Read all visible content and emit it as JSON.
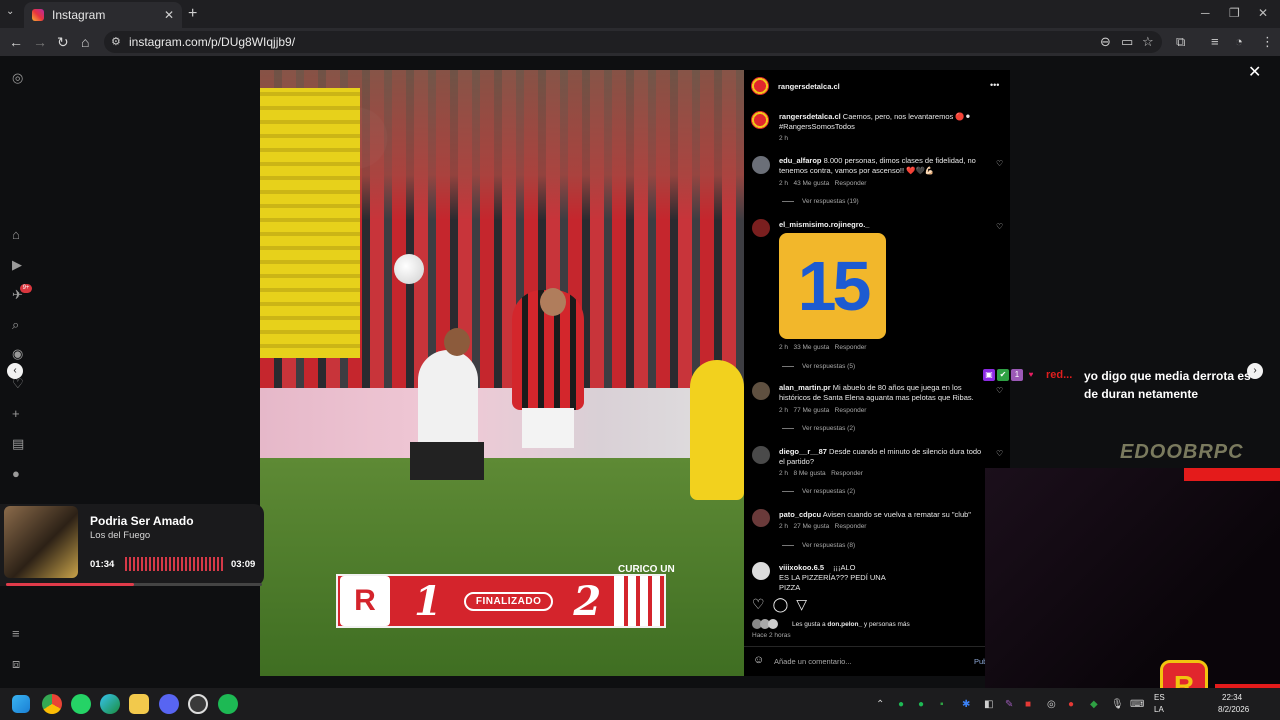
{
  "browser": {
    "tab_title": "Instagram",
    "url": "instagram.com/p/DUg8WIqjjb9/",
    "close_tab": "✕",
    "new_tab": "+"
  },
  "post": {
    "account": "rangersdetalca.cl",
    "more": "•••",
    "caption_user": "rangersdetalca.cl",
    "caption_text": "Caemos, pero, nos levantaremos 🔴⚫",
    "caption_hashtag": "#RangersSomosTodos",
    "caption_time": "2 h",
    "scoreboard": {
      "home_score": "1",
      "away_score": "2",
      "status": "FINALIZADO",
      "away_name": "CURICO UN",
      "home_logo": "R"
    }
  },
  "comments": [
    {
      "user": "edu_alfarop",
      "text": "8.000 personas, dimos clases de fidelidad, no tenemos contra, vamos por ascenso!! ❤️🖤💪🏻",
      "time": "2 h",
      "likes": "43 Me gusta",
      "reply": "Responder",
      "replies": "Ver respuestas (19)"
    },
    {
      "user": "el_mismisimo.rojinegro._",
      "text": "",
      "sticker": "15",
      "time": "2 h",
      "likes": "33 Me gusta",
      "reply": "Responder",
      "replies": "Ver respuestas (5)"
    },
    {
      "user": "alan_martin.pr",
      "text": "Mi abuelo de 80 años que juega en los históricos de Santa Elena aguanta mas pelotas que Ribas.",
      "time": "2 h",
      "likes": "77 Me gusta",
      "reply": "Responder",
      "replies": "Ver respuestas (2)"
    },
    {
      "user": "diego__r__87",
      "text": "Desde cuando el minuto de silencio dura todo el partido?",
      "time": "2 h",
      "likes": "8 Me gusta",
      "reply": "Responder",
      "replies": "Ver respuestas (2)"
    },
    {
      "user": "pato_cdpcu",
      "text": "Avisen cuando se vuelva a rematar su \"club\"",
      "time": "2 h",
      "likes": "27 Me gusta",
      "reply": "Responder",
      "replies": "Ver respuestas (8)"
    },
    {
      "user": "viiixokoo.6.5",
      "text": "¡¡¡ALO\nES LA PIZZERÍA??? PEDÍ UNA\nPIZZA",
      "time": "",
      "likes": "",
      "reply": "",
      "replies": ""
    }
  ],
  "footer": {
    "liked_by": "Les gusta a ",
    "liked_by_user": "don.pelon_",
    "liked_by_rest": " y personas más",
    "time_ago": "Hace 2 horas",
    "comment_placeholder": "Añade un comentario...",
    "publish": "Publ"
  },
  "stream": {
    "chat_user": "red...",
    "chat_message": "yo digo que media derrota es de duran netamente",
    "streamer": "EDOOBRPC"
  },
  "music": {
    "title": "Podria Ser Amado",
    "artist": "Los del Fuego",
    "current": "01:34",
    "total": "03:09",
    "progress": 0.5
  },
  "taskbar": {
    "time": "22:34",
    "date": "8/2/2026",
    "lang1": "ES",
    "lang2": "LA"
  },
  "sidebar": {
    "notifications_badge": "9+"
  },
  "colors": {
    "instagram_bg": "#000000",
    "rangers_red": "#d4242c",
    "stream_red": "#e41b1b",
    "accent_pink": "#e03b4a"
  }
}
